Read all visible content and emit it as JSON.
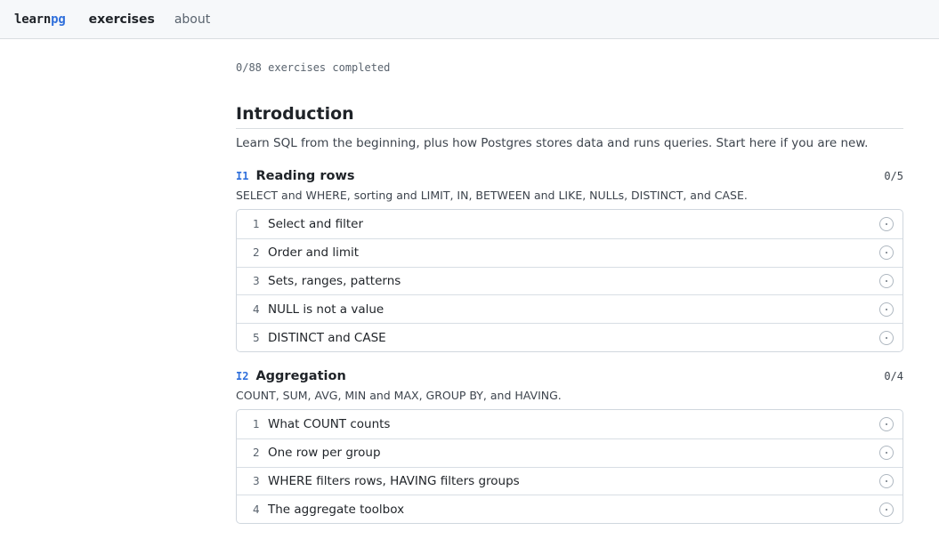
{
  "header": {
    "logo": {
      "part1": "learn",
      "part2": "pg"
    },
    "nav": [
      {
        "label": "exercises",
        "active": true
      },
      {
        "label": "about",
        "active": false
      }
    ]
  },
  "progress_text": "0/88 exercises completed",
  "section": {
    "title": "Introduction",
    "description": "Learn SQL from the beginning, plus how Postgres stores data and runs queries. Start here if you are new.",
    "groups": [
      {
        "code": "I1",
        "name": "Reading rows",
        "count": "0/5",
        "description": "SELECT and WHERE, sorting and LIMIT, IN, BETWEEN and LIKE, NULLs, DISTINCT, and CASE.",
        "items": [
          {
            "num": "1",
            "label": "Select and filter"
          },
          {
            "num": "2",
            "label": "Order and limit"
          },
          {
            "num": "3",
            "label": "Sets, ranges, patterns"
          },
          {
            "num": "4",
            "label": "NULL is not a value"
          },
          {
            "num": "5",
            "label": "DISTINCT and CASE"
          }
        ]
      },
      {
        "code": "I2",
        "name": "Aggregation",
        "count": "0/4",
        "description": "COUNT, SUM, AVG, MIN and MAX, GROUP BY, and HAVING.",
        "items": [
          {
            "num": "1",
            "label": "What COUNT counts"
          },
          {
            "num": "2",
            "label": "One row per group"
          },
          {
            "num": "3",
            "label": "WHERE filters rows, HAVING filters groups"
          },
          {
            "num": "4",
            "label": "The aggregate toolbox"
          }
        ]
      }
    ]
  },
  "icons": {
    "status": "incomplete-circle-icon"
  },
  "colors": {
    "accent": "#2f6fdb",
    "topbar_bg": "#f6f8fa"
  }
}
